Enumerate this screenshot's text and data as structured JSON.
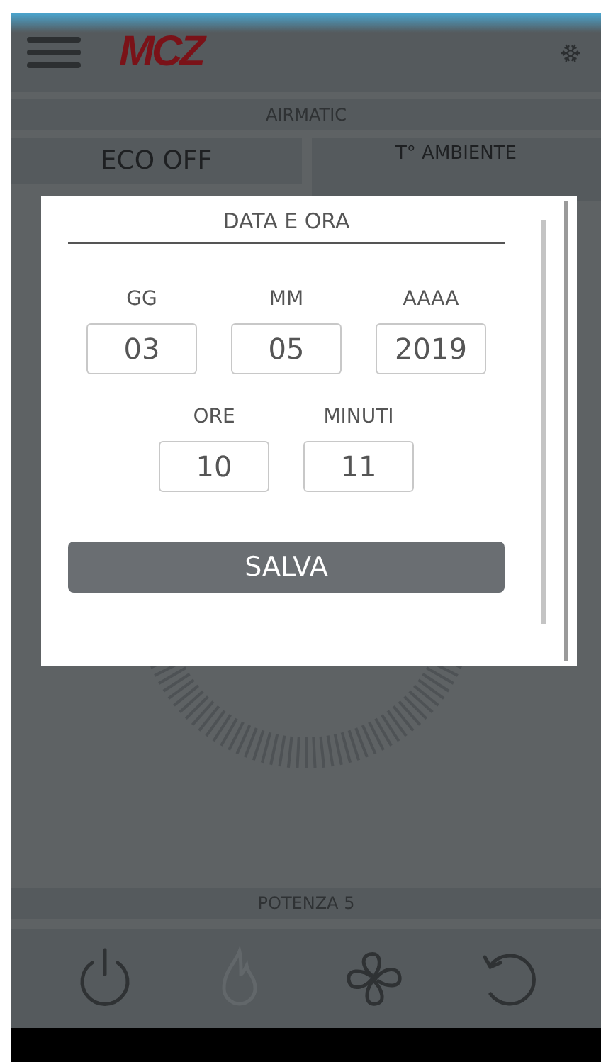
{
  "header": {
    "logo": "MCZ"
  },
  "mode_band": {
    "label": "AIRMATIC"
  },
  "status_cells": [
    {
      "label": "ECO OFF"
    },
    {
      "label": "T° AMBIENTE"
    }
  ],
  "dialog": {
    "title": "DATA E ORA",
    "date_fields": [
      {
        "label": "GG",
        "value": "03"
      },
      {
        "label": "MM",
        "value": "05"
      },
      {
        "label": "AAAA",
        "value": "2019"
      }
    ],
    "time_fields": [
      {
        "label": "ORE",
        "value": "10"
      },
      {
        "label": "MINUTI",
        "value": "11"
      }
    ],
    "save_button": "SALVA"
  },
  "power_band": {
    "label": "POTENZA 5"
  },
  "controls": [
    {
      "disabled": false
    },
    {
      "disabled": true
    },
    {
      "disabled": false
    },
    {
      "disabled": false
    }
  ]
}
